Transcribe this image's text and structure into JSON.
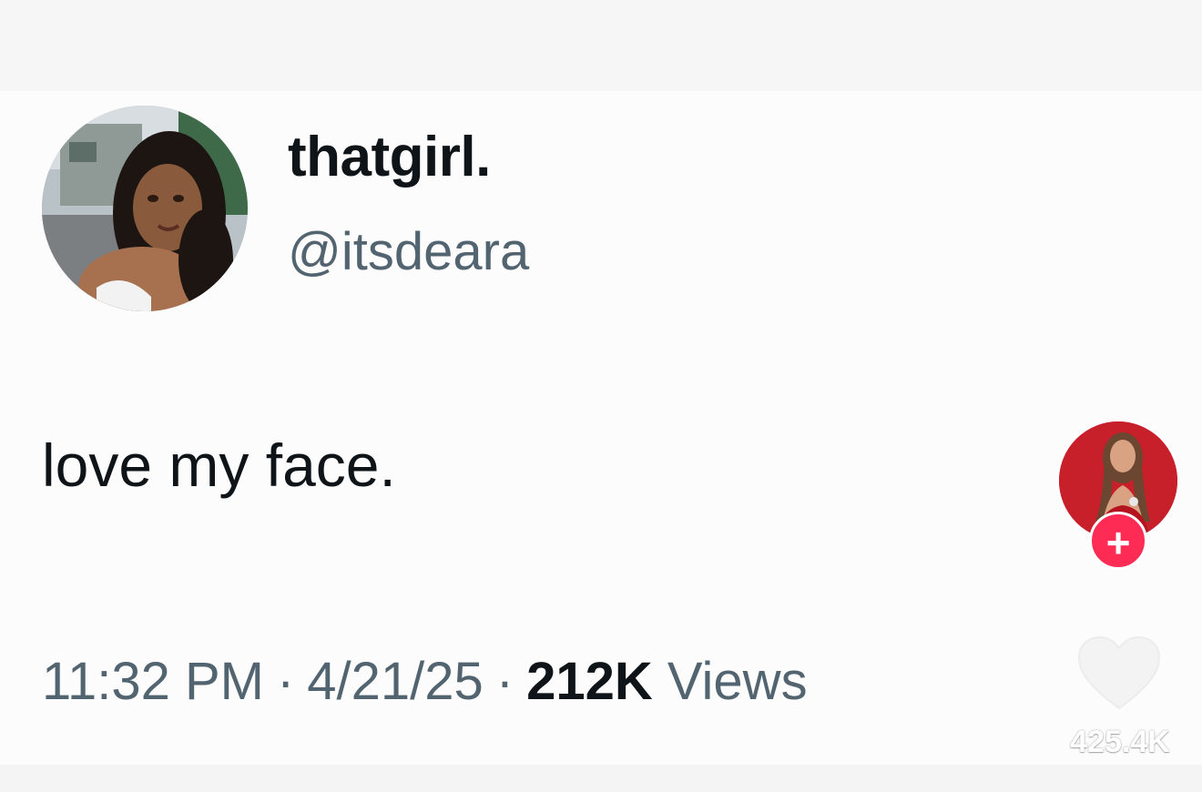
{
  "tweet": {
    "display_name": "thatgirl.",
    "handle": "@itsdeara",
    "text": "love my face.",
    "time": "11:32 PM",
    "date": "4/21/25",
    "views_count": "212K",
    "views_label": "Views",
    "separator": "·"
  },
  "overlay": {
    "follow_symbol": "+",
    "like_count": "425.4K",
    "icons": [
      "avatar-photo",
      "creator-avatar-photo",
      "plus-icon",
      "heart-icon"
    ],
    "accent_color": "#fe2c55"
  }
}
